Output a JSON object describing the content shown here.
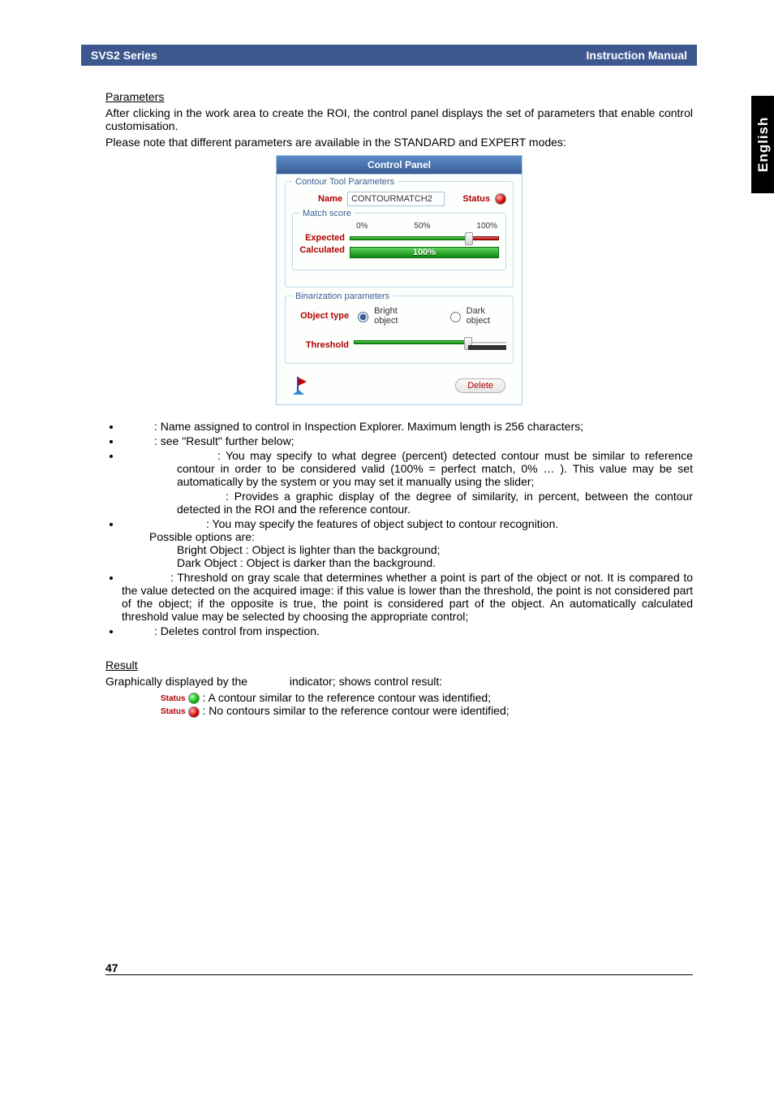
{
  "header": {
    "left": "SVS2 Series",
    "right": "Instruction Manual"
  },
  "sideTab": "English",
  "sections": {
    "parametersHeading": "Parameters",
    "resultHeading": "Result"
  },
  "intro": {
    "p1": "After clicking in the work area to create the ROI, the control panel displays the set of parameters that enable control customisation.",
    "p2": "Please note that different parameters are available in the STANDARD and EXPERT modes:"
  },
  "panel": {
    "title": "Control Panel",
    "group1Title": "Contour Tool Parameters",
    "nameLabel": "Name",
    "nameValue": "CONTOURMATCH2",
    "statusLabel": "Status",
    "matchScoreTitle": "Match score",
    "scale0": "0%",
    "scale50": "50%",
    "scale100": "100%",
    "expectedLabel": "Expected",
    "calculatedLabel": "Calculated",
    "calculatedValue": "100%",
    "group2Title": "Binarization parameters",
    "objectTypeLabel": "Object type",
    "brightObject": "Bright object",
    "darkObject": "Dark object",
    "thresholdLabel": "Threshold",
    "deleteLabel": "Delete"
  },
  "bullets": {
    "b1": ": Name assigned to control in Inspection Explorer. Maximum length is 256 characters;",
    "b2": ": see \"Result\" further below;",
    "b3a": ": You may specify to what degree (percent) detected contour must be similar to reference contour in order to be considered valid (100% = perfect match, 0% … ). This value may be set automatically by the system or you may set it manually using the slider;",
    "b3b": ": Provides a graphic display of the degree of similarity, in percent, between the contour detected in the ROI and the reference contour.",
    "b4intro": ": You may specify the features of object subject to contour recognition.",
    "b4opts": "Possible options are:",
    "b4o1": "Bright Object : Object is lighter than the background;",
    "b4o2": "Dark Object : Object is darker than the background.",
    "b5": ": Threshold on gray scale that determines whether a point is part of the object or not. It is compared to the value detected on the acquired image: if this value is lower than the threshold, the point is not considered part of the object; if the opposite is true, the point is considered part of the object. An automatically calculated threshold value may be selected by choosing the appropriate control;",
    "b6": ": Deletes control from inspection."
  },
  "result": {
    "p1a": "Graphically displayed by the ",
    "p1b": " indicator; shows control result:",
    "g": ": A contour similar to the reference contour was identified;",
    "r": ": No contours similar to the reference contour were identified;",
    "statusWord": "Status"
  },
  "pageNumber": "47"
}
